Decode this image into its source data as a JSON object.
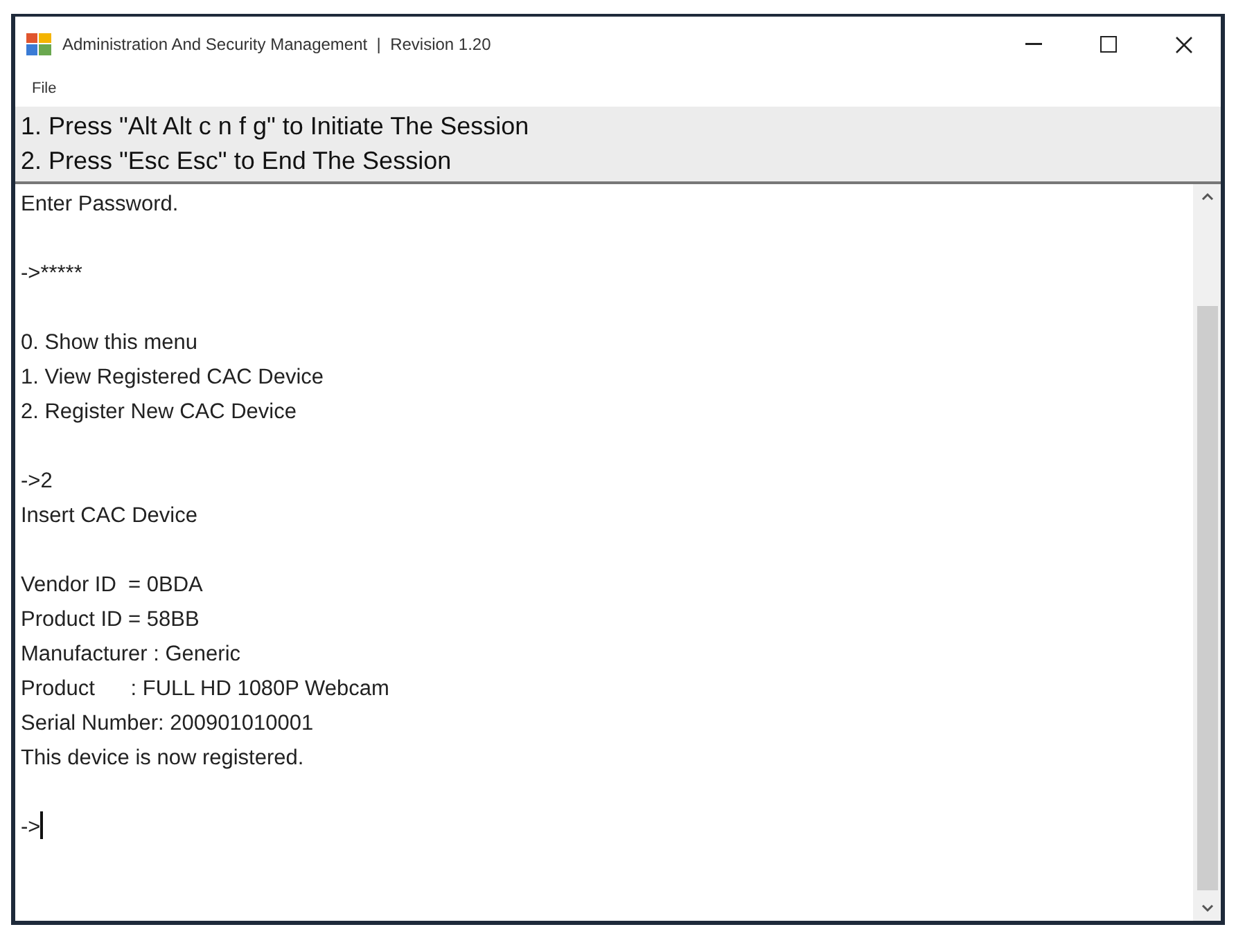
{
  "window": {
    "title": "Administration And Security Management  |  Revision 1.20"
  },
  "menu": [
    "File"
  ],
  "instructions": [
    "1. Press \"Alt Alt c n f g\" to Initiate The Session",
    "2. Press \"Esc Esc\" to End The Session"
  ],
  "console": {
    "groups": [
      [
        "Enter Password."
      ],
      [
        "->*****"
      ],
      [
        "0. Show this menu",
        "1. View Registered CAC Device",
        "2. Register New CAC Device"
      ],
      [
        "->2",
        "Insert CAC Device"
      ],
      [
        "Vendor ID  = 0BDA",
        "Product ID = 58BB",
        "Manufacturer : Generic",
        "Product      : FULL HD 1080P Webcam",
        "Serial Number: 200901010001",
        "This device is now registered."
      ],
      [
        "->"
      ]
    ],
    "cursor": true
  }
}
